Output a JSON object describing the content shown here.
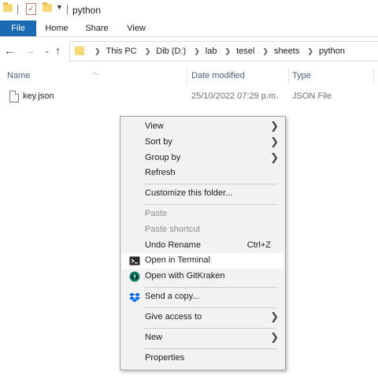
{
  "window": {
    "title": "python"
  },
  "ribbon": {
    "tabs": [
      "File",
      "Home",
      "Share",
      "View"
    ]
  },
  "address": {
    "crumbs": [
      "This PC",
      "Dib (D:)",
      "lab",
      "tesel",
      "sheets",
      "python"
    ]
  },
  "columns": {
    "name": "Name",
    "date": "Date modified",
    "type": "Type"
  },
  "files": [
    {
      "name": "key.json",
      "date": "25/10/2022 07:29 p.m.",
      "type": "JSON File"
    }
  ],
  "menu": {
    "view": "View",
    "sort_by": "Sort by",
    "group_by": "Group by",
    "refresh": "Refresh",
    "customize": "Customize this folder...",
    "paste": "Paste",
    "paste_shortcut": "Paste shortcut",
    "undo_rename": "Undo Rename",
    "undo_shortcut": "Ctrl+Z",
    "open_terminal": "Open in Terminal",
    "open_gitkraken": "Open with GitKraken",
    "send_copy": "Send a copy...",
    "give_access": "Give access to",
    "new": "New",
    "properties": "Properties"
  },
  "icons": {
    "terminal": "terminal-icon",
    "gitkraken": "gitkraken-icon",
    "dropbox": "dropbox-icon",
    "submenu": "chevron-right-icon"
  },
  "colors": {
    "file_tab": "#1a6ab3",
    "folder": "#f8d775",
    "dropbox": "#0061fe",
    "gitkraken": "#0f7b6c"
  }
}
